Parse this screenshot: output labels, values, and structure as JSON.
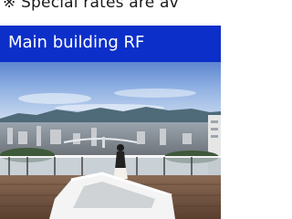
{
  "notice": {
    "text": "※ Special rates are av"
  },
  "header": {
    "title": "Main building RF"
  },
  "photo": {
    "alt": "rooftop-city-view-photo"
  },
  "colors": {
    "header_bg": "#0d2fc9",
    "header_text": "#ffffff",
    "notice_text": "#1a1a1a"
  }
}
